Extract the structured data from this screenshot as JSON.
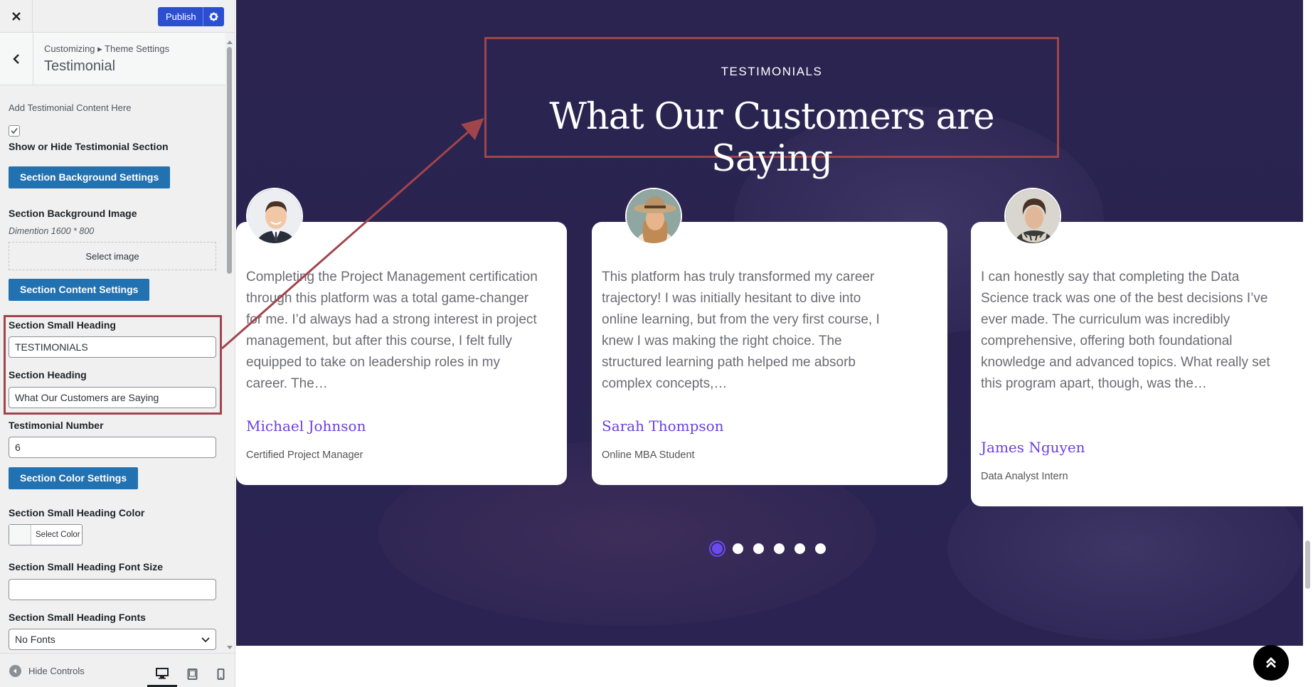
{
  "topbar": {
    "publish_label": "Publish"
  },
  "header": {
    "breadcrumb": "Customizing ▸ Theme Settings",
    "title": "Testimonial"
  },
  "panel": {
    "intro": "Add Testimonial Content Here",
    "show_hide_label": "Show or Hide Testimonial Section",
    "show_hide_checked": true,
    "bg_settings_button": "Section Background Settings",
    "bg_image_label": "Section Background Image",
    "bg_image_note": "Dimention 1600 * 800",
    "select_image_button": "Select image",
    "content_settings_button": "Section Content Settings",
    "small_heading_label": "Section Small Heading",
    "small_heading_value": "TESTIMONIALS",
    "heading_label": "Section Heading",
    "heading_value": "What Our Customers are Saying",
    "number_label": "Testimonial Number",
    "number_value": "6",
    "color_settings_button": "Section Color Settings",
    "small_heading_color_label": "Section Small Heading Color",
    "select_color_label": "Select Color",
    "small_heading_font_size_label": "Section Small Heading Font Size",
    "small_heading_font_size_value": "",
    "small_heading_fonts_label": "Section Small Heading Fonts",
    "small_heading_fonts_value": "No Fonts"
  },
  "footer": {
    "hide_controls_label": "Hide Controls"
  },
  "preview": {
    "small_heading": "TESTIMONIALS",
    "heading": "What Our Customers are Saying",
    "accent_color": "#6b3fe0",
    "highlight_color": "#a0454b",
    "testimonials": [
      {
        "quote": "Completing the Project Management certification through this platform was a total game-changer for me. I’d always had a strong interest in project management, but after this course, I felt fully equipped to take on leadership roles in my career. The…",
        "name": "Michael Johnson",
        "role": "Certified Project Manager"
      },
      {
        "quote": "This platform has truly transformed my career trajectory! I was initially hesitant to dive into online learning, but from the very first course, I knew I was making the right choice. The structured learning path helped me absorb complex concepts,…",
        "name": "Sarah Thompson",
        "role": "Online MBA Student"
      },
      {
        "quote": "I can honestly say that completing the Data Science track was one of the best decisions I’ve ever made. The curriculum was incredibly comprehensive, offering both foundational knowledge and advanced topics. What really set this program apart, though, was the…",
        "name": "James Nguyen",
        "role": "Data Analyst Intern"
      }
    ],
    "slider": {
      "total": 6,
      "active": 1
    }
  }
}
